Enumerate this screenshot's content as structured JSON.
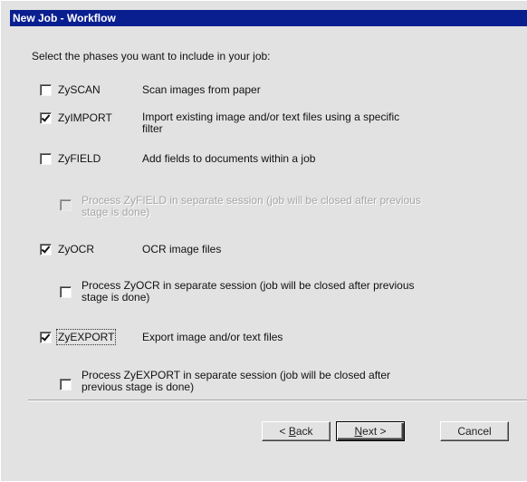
{
  "window": {
    "title": "New Job - Workflow"
  },
  "instructions": "Select the phases you want to include in your job:",
  "phases": [
    {
      "key": "zyscan",
      "name": "ZySCAN",
      "description": "Scan images from paper",
      "checked": false
    },
    {
      "key": "zyimport",
      "name": "ZyIMPORT",
      "description": "Import existing image and/or text files using a specific filter",
      "checked": true
    },
    {
      "key": "zyfield",
      "name": "ZyFIELD",
      "description": "Add fields to documents within a job",
      "checked": false
    },
    {
      "key": "zyfield_session",
      "name": "Process ZyFIELD in separate session (job will be closed after previous stage is done)",
      "checked": false,
      "disabled": true
    },
    {
      "key": "zyocr",
      "name": "ZyOCR",
      "description": "OCR image files",
      "checked": true
    },
    {
      "key": "zyocr_session",
      "name": "Process ZyOCR in separate session (job will be closed after previous stage is done)",
      "checked": false
    },
    {
      "key": "zyexport",
      "name": "ZyEXPORT",
      "description": "Export image and/or text files",
      "checked": true,
      "focused": true
    },
    {
      "key": "zyexport_session",
      "name": "Process ZyEXPORT in separate session (job will be closed after previous stage is done)",
      "checked": false
    }
  ],
  "buttons": {
    "back": {
      "prefix": "< ",
      "accel": "B",
      "rest": "ack"
    },
    "next": {
      "accel": "N",
      "rest": "ext",
      "suffix": " >"
    },
    "cancel": "Cancel"
  }
}
